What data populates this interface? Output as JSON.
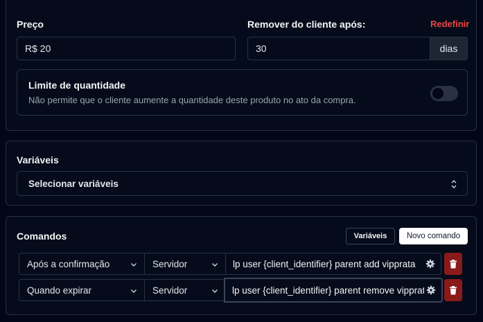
{
  "pricing": {
    "price_label": "Preço",
    "price_value": "R$ 20",
    "remove_label": "Remover do cliente após:",
    "reset_label": "Redefinir",
    "remove_value": "30",
    "remove_unit": "dias",
    "limit_title": "Limite de quantidade",
    "limit_desc": "Não permite que o cliente aumente a quantidade deste produto no ato da compra.",
    "limit_enabled": false
  },
  "variables": {
    "title": "Variáveis",
    "select_value": "Selecionar variáveis"
  },
  "commands": {
    "title": "Comandos",
    "variables_button": "Variáveis",
    "new_button": "Novo comando",
    "rows": [
      {
        "trigger": "Após a confirmação",
        "target": "Servidor",
        "command": "lp user {client_identifier} parent add vipprata"
      },
      {
        "trigger": "Quando expirar",
        "target": "Servidor",
        "command": "lp user {client_identifier} parent remove vipprata"
      }
    ]
  },
  "colors": {
    "background": "#020617",
    "danger": "#ef4444",
    "trash_bg": "#8b1a1a"
  }
}
